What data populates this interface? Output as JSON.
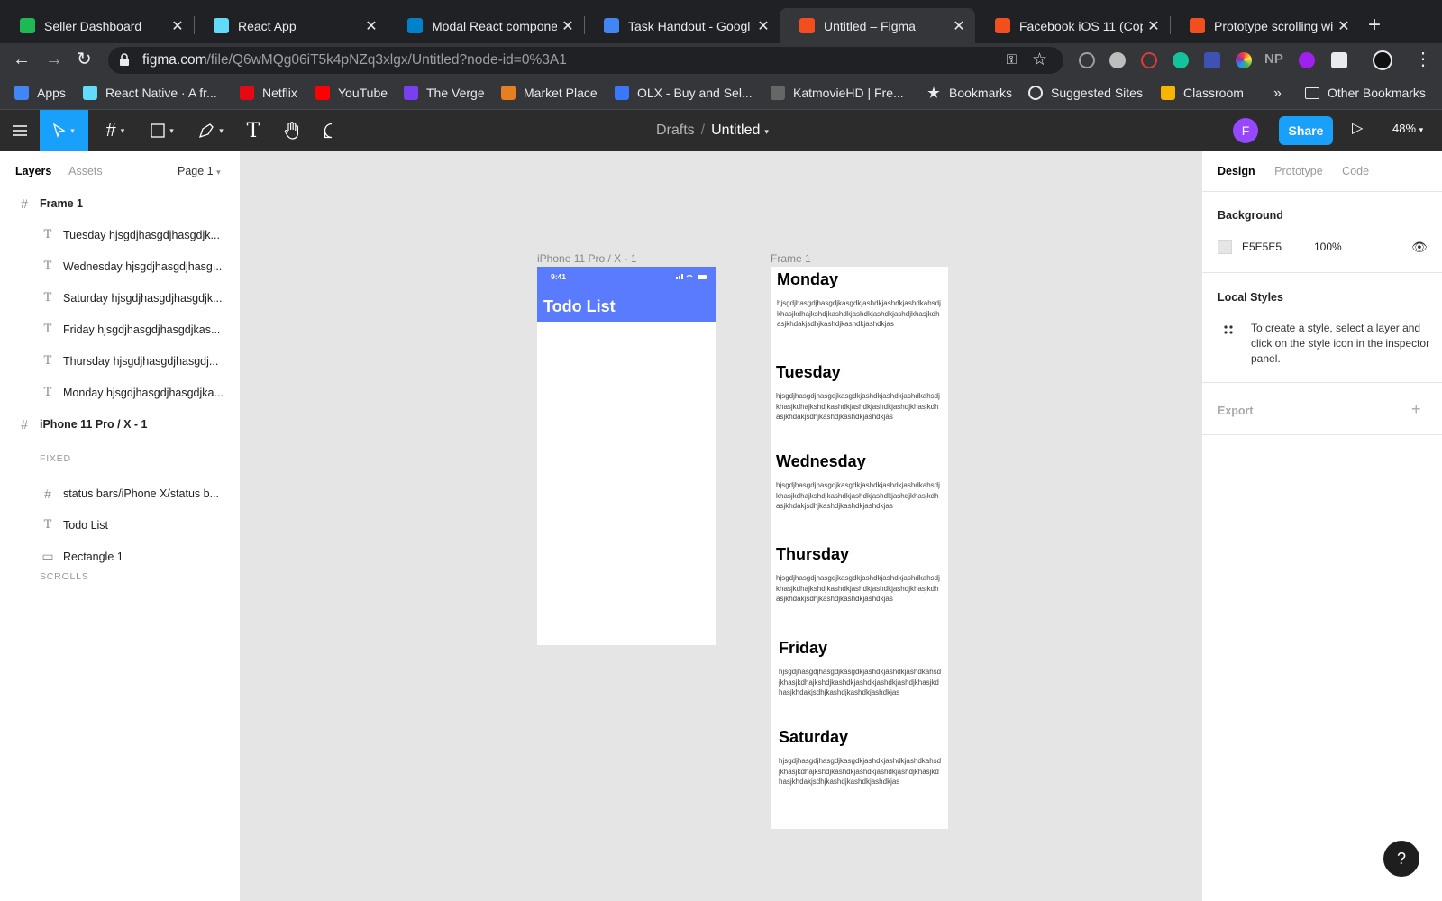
{
  "browser": {
    "tabs": [
      {
        "title": "Seller Dashboard",
        "icon": "seller-icon",
        "color": "#1db954"
      },
      {
        "title": "React App",
        "icon": "react-icon",
        "color": "#61dafb"
      },
      {
        "title": "Modal React compone",
        "icon": "mui-icon",
        "color": "#0081cb"
      },
      {
        "title": "Task Handout - Googl",
        "icon": "docs-icon",
        "color": "#4285f4"
      },
      {
        "title": "Untitled – Figma",
        "icon": "figma-icon",
        "color": "#f24e1e"
      },
      {
        "title": "Facebook iOS 11 (Cop",
        "icon": "figma-icon",
        "color": "#f24e1e"
      },
      {
        "title": "Prototype scrolling wit",
        "icon": "figma-icon",
        "color": "#f24e1e"
      }
    ],
    "url_host": "figma.com",
    "url_path": "/file/Q6wMQg06iT5k4pNZq3xlgx/Untitled?node-id=0%3A1",
    "bookmarks": [
      {
        "label": "Apps",
        "icon": "apps-grid-icon",
        "color": "#4285f4"
      },
      {
        "label": "React Native · A fr...",
        "icon": "react-icon",
        "color": "#61dafb"
      },
      {
        "label": "Netflix",
        "icon": "netflix-icon",
        "color": "#e50914"
      },
      {
        "label": "YouTube",
        "icon": "youtube-icon",
        "color": "#ff0000"
      },
      {
        "label": "The Verge",
        "icon": "verge-icon",
        "color": "#7b3ff2"
      },
      {
        "label": "Market Place",
        "icon": "marketplace-icon",
        "color": "#e67e22"
      },
      {
        "label": "OLX - Buy and Sel...",
        "icon": "olx-icon",
        "color": "#3a77ff"
      },
      {
        "label": "KatmovieHD | Fre...",
        "icon": "katmovie-icon",
        "color": "#666666"
      },
      {
        "label": "Bookmarks",
        "icon": "star-icon",
        "color": "#e8eaed"
      },
      {
        "label": "Suggested Sites",
        "icon": "globe-icon",
        "color": "#e8eaed"
      },
      {
        "label": "Classroom",
        "icon": "classroom-icon",
        "color": "#f7b500"
      }
    ],
    "more_bookmarks": "»",
    "other_bookmarks": "Other Bookmarks"
  },
  "figma": {
    "breadcrumb_drafts": "Drafts",
    "file_name": "Untitled",
    "avatar_initial": "F",
    "share_label": "Share",
    "zoom": "48%",
    "layers_tab": "Layers",
    "assets_tab": "Assets",
    "page_selector": "Page 1",
    "layers": [
      {
        "name": "Frame 1",
        "type": "frame"
      },
      {
        "name": "Tuesday hjsgdjhasgdjhasgdjk...",
        "type": "text"
      },
      {
        "name": "Wednesday hjsgdjhasgdjhasg...",
        "type": "text"
      },
      {
        "name": "Saturday hjsgdjhasgdjhasgdjk...",
        "type": "text"
      },
      {
        "name": "Friday hjsgdjhasgdjhasgdjkas...",
        "type": "text"
      },
      {
        "name": "Thursday hjsgdjhasgdjhasgdj...",
        "type": "text"
      },
      {
        "name": "Monday hjsgdjhasgdjhasgdjka...",
        "type": "text"
      },
      {
        "name": "iPhone 11 Pro / X - 1",
        "type": "frame"
      },
      {
        "name": "status bars/iPhone X/status b...",
        "type": "component"
      },
      {
        "name": "Todo List",
        "type": "text"
      },
      {
        "name": "Rectangle 1",
        "type": "rect"
      }
    ],
    "section_fixed": "FIXED",
    "section_scrolls": "SCROLLS",
    "canvas": {
      "phone_label": "iPhone 11 Pro / X - 1",
      "phone_time": "9:41",
      "phone_title": "Todo List",
      "phone_header_color": "#5b7bfe",
      "frame_label": "Frame 1",
      "days": [
        {
          "name": "Monday",
          "text": "hjsgdjhasgdjhasgdjkasgdkjashdkjashdkjashdkahsdjkhasjkdhajkshdjkashdkjashdkjashdkjashdjkhasjkdhasjkhdakjsdhjkashdjkashdkjashdkjas"
        },
        {
          "name": "Tuesday",
          "text": "hjsgdjhasgdjhasgdjkasgdkjashdkjashdkjashdkahsdjkhasjkdhajkshdjkashdkjashdkjashdkjashdjkhasjkdhasjkhdakjsdhjkashdjkashdkjashdkjas"
        },
        {
          "name": "Wednesday",
          "text": "hjsgdjhasgdjhasgdjkasgdkjashdkjashdkjashdkahsdjkhasjkdhajkshdjkashdkjashdkjashdkjashdjkhasjkdhasjkhdakjsdhjkashdjkashdkjashdkjas"
        },
        {
          "name": "Thursday",
          "text": "hjsgdjhasgdjhasgdjkasgdkjashdkjashdkjashdkahsdjkhasjkdhajkshdjkashdkjashdkjashdkjashdjkhasjkdhasjkhdakjsdhjkashdjkashdkjashdkjas"
        },
        {
          "name": "Friday",
          "text": "hjsgdjhasgdjhasgdjkasgdkjashdkjashdkjashdkahsdjkhasjkdhajkshdjkashdkjashdkjashdkjashdjkhasjkdhasjkhdakjsdhjkashdjkashdkjashdkjas"
        },
        {
          "name": "Saturday",
          "text": "hjsgdjhasgdjhasgdjkasgdkjashdkjashdkjashdkahsdjkhasjkdhajkshdjkashdkjashdkjashdkjashdjkhasjkdhasjkhdakjsdhjkashdjkashdkjashdkjas"
        }
      ]
    },
    "inspector": {
      "tabs": [
        "Design",
        "Prototype",
        "Code"
      ],
      "background_heading": "Background",
      "background_hex": "E5E5E5",
      "background_opacity": "100%",
      "local_styles_heading": "Local Styles",
      "local_styles_hint": "To create a style, select a layer and click on the style icon in the inspector panel.",
      "export_heading": "Export"
    },
    "help_label": "?"
  }
}
